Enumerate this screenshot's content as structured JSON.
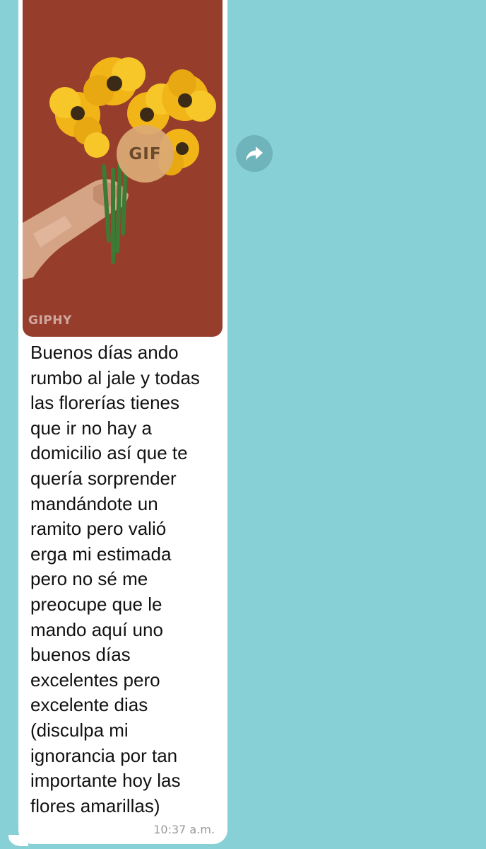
{
  "message": {
    "gif": {
      "badge_label": "GIF",
      "source_label": "GIPHY"
    },
    "text": "Buenos días ando\nrumbo al jale y todas\nlas florerías tienes\nque ir no hay a\ndomicilio así que te\nquería sorprender\nmandándote un\nramito pero valió\nerga mi estimada\npero no sé  me\npreocupe que le\nmando aquí uno\nbuenos días\nexcelentes pero\nexcelente dias\n(disculpa mi\nignorancia por tan\nimportante hoy las\nflores amarillas)",
    "timestamp": "10:37 a.m."
  },
  "actions": {
    "forward_icon": "forward-arrow-icon"
  },
  "colors": {
    "chat_background": "#86d0d6",
    "bubble": "#ffffff",
    "gif_background": "#973d2b",
    "flower_petal": "#f2b518",
    "forward_button": "#6eb4ba"
  }
}
